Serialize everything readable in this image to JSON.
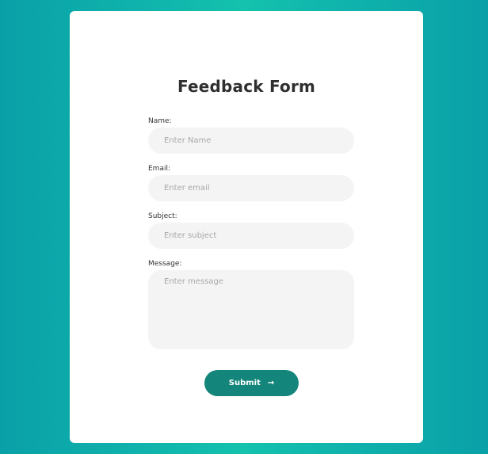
{
  "form": {
    "title": "Feedback Form",
    "fields": [
      {
        "label": "Name:",
        "placeholder": "Enter Name",
        "value": ""
      },
      {
        "label": "Email:",
        "placeholder": "Enter email",
        "value": ""
      },
      {
        "label": "Subject:",
        "placeholder": "Enter subject",
        "value": ""
      },
      {
        "label": "Message:",
        "placeholder": "Enter message",
        "value": ""
      }
    ],
    "submit": {
      "label": "Submit",
      "icon": "arrow-right-icon",
      "arrow": "→"
    }
  },
  "colors": {
    "background_gradient": [
      "#0aa0a8",
      "#14c2ad"
    ],
    "card": "#ffffff",
    "field_bg": "#f4f4f4",
    "button": "#14857a",
    "title_text": "#2f2f2f"
  }
}
